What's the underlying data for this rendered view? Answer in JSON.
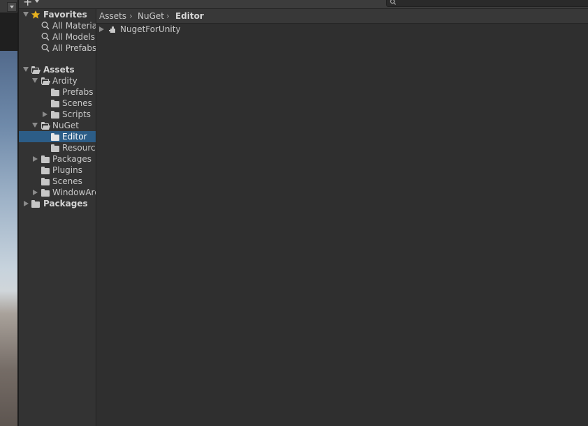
{
  "toolbar": {
    "add_symbol": "+",
    "search": {
      "value": "",
      "placeholder": ""
    }
  },
  "favorites": {
    "title": "Favorites",
    "items": [
      {
        "label": "All Materials"
      },
      {
        "label": "All Models"
      },
      {
        "label": "All Prefabs"
      }
    ]
  },
  "tree": {
    "assets": {
      "label": "Assets",
      "ardity": {
        "label": "Ardity",
        "children": [
          {
            "label": "Prefabs"
          },
          {
            "label": "Scenes"
          },
          {
            "label": "Scripts"
          }
        ]
      },
      "nuget": {
        "label": "NuGet",
        "children": [
          {
            "label": "Editor"
          },
          {
            "label": "Resources"
          }
        ]
      },
      "others": [
        {
          "label": "Packages"
        },
        {
          "label": "Plugins"
        },
        {
          "label": "Scenes"
        },
        {
          "label": "WindowArd"
        }
      ]
    },
    "packages": {
      "label": "Packages"
    }
  },
  "breadcrumb": {
    "items": [
      "Assets",
      "NuGet",
      "Editor"
    ],
    "separator": "›"
  },
  "content": {
    "items": [
      {
        "label": "NugetForUnity"
      }
    ]
  },
  "colors": {
    "selection": "#2c5d87",
    "favorite_star": "#e8b21e",
    "panel_bg": "#333333",
    "content_bg": "#2f2f2f"
  }
}
